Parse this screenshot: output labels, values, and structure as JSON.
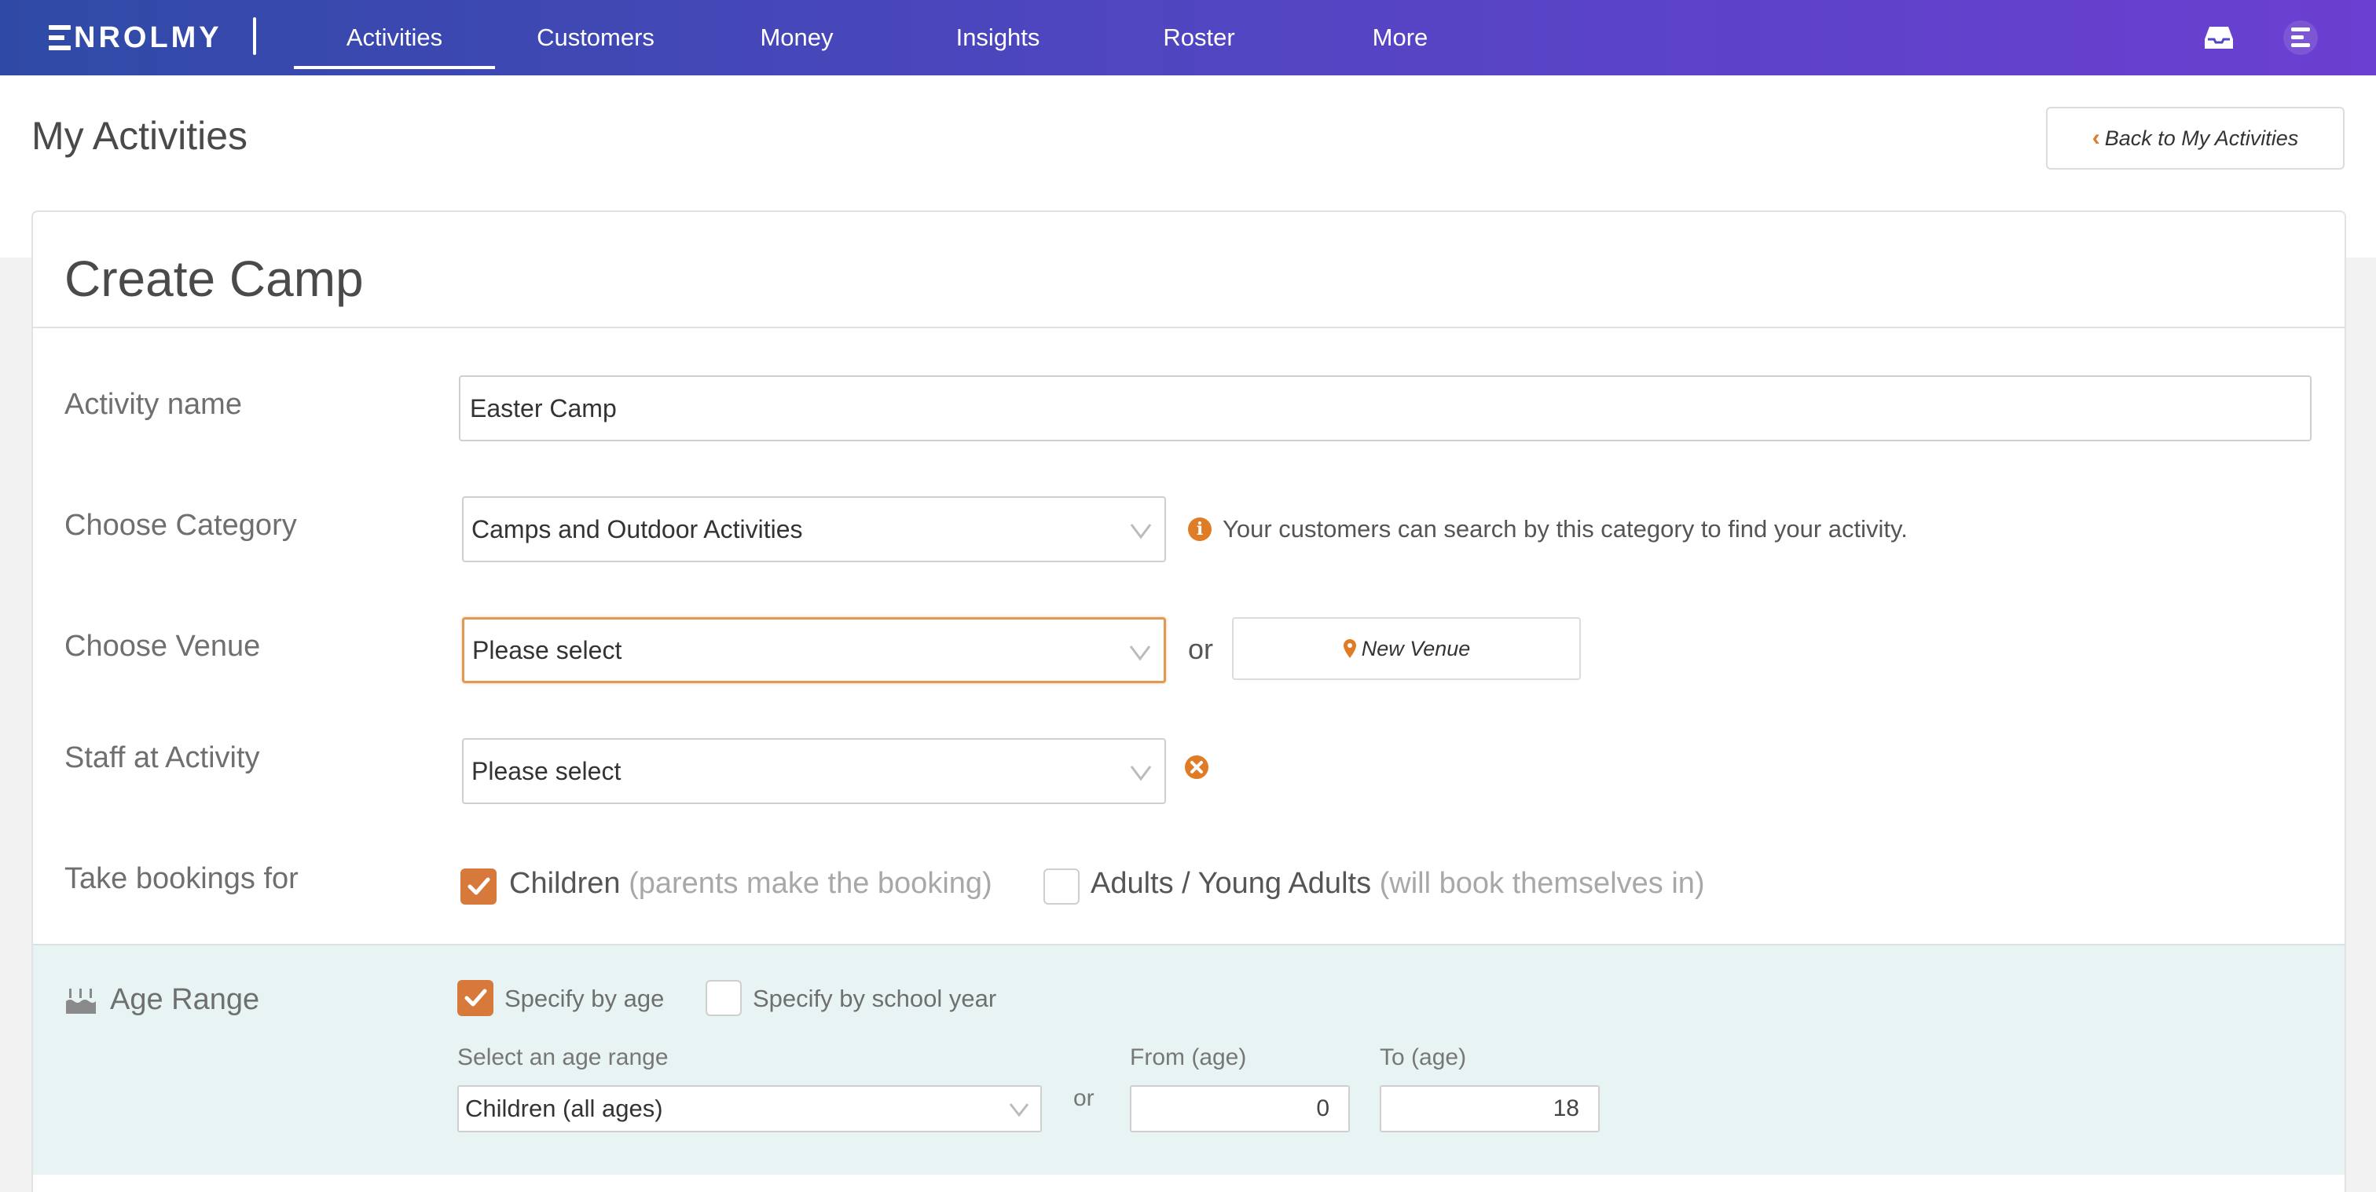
{
  "nav": {
    "logo": "NROLMY",
    "items": [
      "Activities",
      "Customers",
      "Money",
      "Insights",
      "Roster",
      "More"
    ],
    "active": "Activities",
    "icons": [
      "inbox-icon",
      "menu-icon"
    ]
  },
  "header": {
    "title": "My Activities",
    "back_label": "Back to My Activities"
  },
  "card": {
    "title": "Create Camp"
  },
  "form": {
    "activity_name": {
      "label": "Activity name",
      "value": "Easter Camp"
    },
    "category": {
      "label": "Choose Category",
      "value": "Camps and Outdoor Activities",
      "hint": "Your customers can search by this category to find your activity."
    },
    "venue": {
      "label": "Choose Venue",
      "value": "Please select",
      "or": "or",
      "new_venue_label": "New Venue"
    },
    "staff": {
      "label": "Staff at Activity",
      "value": "Please select"
    },
    "bookings": {
      "label": "Take bookings for",
      "children": {
        "label": "Children",
        "note": "(parents make the booking)",
        "checked": true
      },
      "adults": {
        "label": "Adults / Young Adults",
        "note": "(will book themselves in)",
        "checked": false
      }
    }
  },
  "age_range": {
    "title": "Age Range",
    "by_age": {
      "label": "Specify by age",
      "checked": true
    },
    "by_school_year": {
      "label": "Specify by school year",
      "checked": false
    },
    "select_label": "Select an age range",
    "select_value": "Children (all ages)",
    "or": "or",
    "from_label": "From (age)",
    "from_value": "0",
    "to_label": "To (age)",
    "to_value": "18"
  },
  "colors": {
    "nav_start": "#2f4aa6",
    "nav_end": "#6b3fd1",
    "accent": "#e07b26",
    "age_bg": "#e8f4f4"
  }
}
